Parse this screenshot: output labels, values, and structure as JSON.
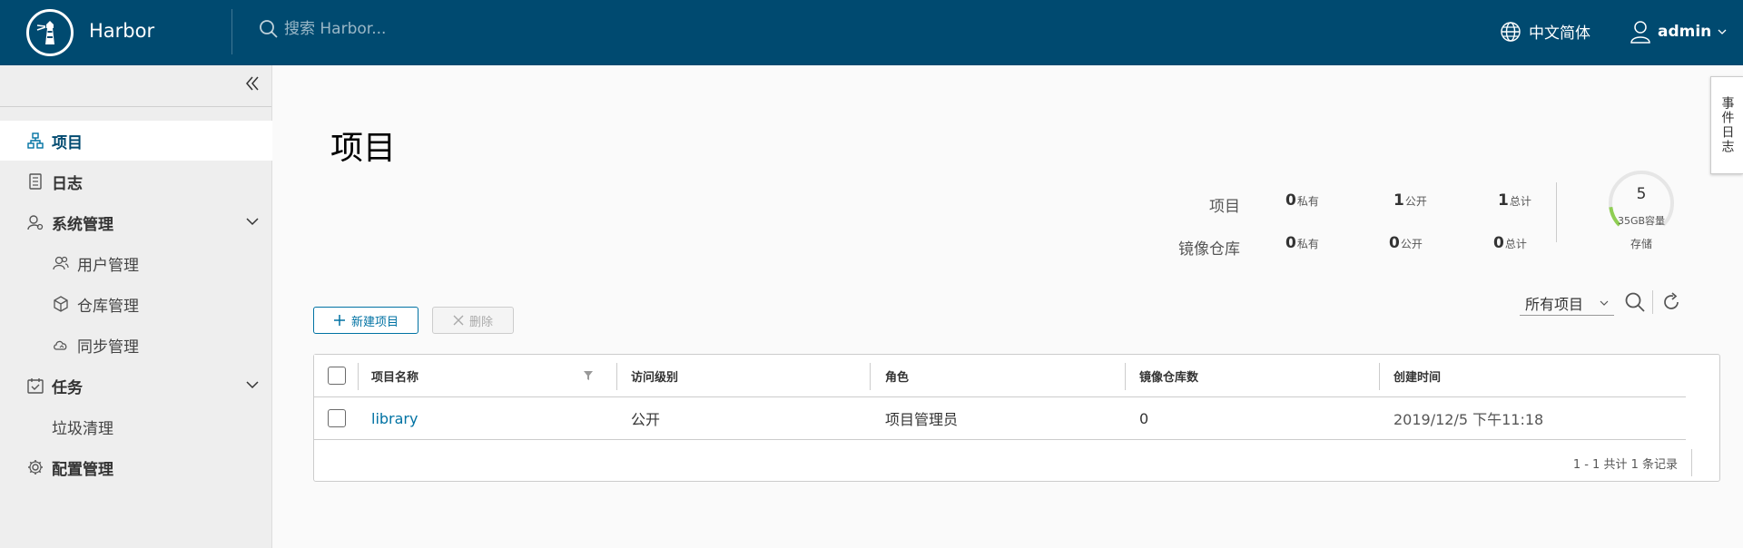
{
  "header": {
    "brand": "Harbor",
    "search_placeholder": "搜索 Harbor...",
    "language": "中文简体",
    "user": "admin"
  },
  "sidebar": {
    "items": [
      {
        "label": "项目",
        "icon": "projects-icon"
      },
      {
        "label": "日志",
        "icon": "logs-icon"
      },
      {
        "label": "系统管理",
        "icon": "admin-icon"
      },
      {
        "label": "用户管理",
        "icon": "users-icon"
      },
      {
        "label": "仓库管理",
        "icon": "registry-icon"
      },
      {
        "label": "同步管理",
        "icon": "replication-icon"
      },
      {
        "label": "任务",
        "icon": "tasks-icon"
      },
      {
        "label": "垃圾清理",
        "icon": ""
      },
      {
        "label": "配置管理",
        "icon": "gear-icon"
      }
    ]
  },
  "main": {
    "title": "项目",
    "stats": {
      "projects_label": "项目",
      "repos_label": "镜像仓库",
      "projects": {
        "private": "0",
        "public": "1",
        "total": "1"
      },
      "repos": {
        "private": "0",
        "public": "0",
        "total": "0"
      },
      "private_suffix": "私有",
      "public_suffix": "公开",
      "total_suffix": "总计"
    },
    "storage": {
      "value": "5",
      "capacity": "35GB容量",
      "label": "存储",
      "used_fraction": 0.14
    },
    "toolbar": {
      "new_label": "新建项目",
      "delete_label": "删除",
      "filter_value": "所有项目"
    },
    "table": {
      "columns": [
        "项目名称",
        "访问级别",
        "角色",
        "镜像仓库数",
        "创建时间"
      ],
      "rows": [
        {
          "name": "library",
          "access": "公开",
          "role": "项目管理员",
          "repo_count": "0",
          "created": "2019/12/5 下午11:18"
        }
      ],
      "footer": "1 - 1 共计 1 条记录"
    },
    "event_tab": "事件日志"
  },
  "colors": {
    "header_bg": "#004a70",
    "accent": "#0072a3",
    "gauge_green": "#8fce53"
  }
}
